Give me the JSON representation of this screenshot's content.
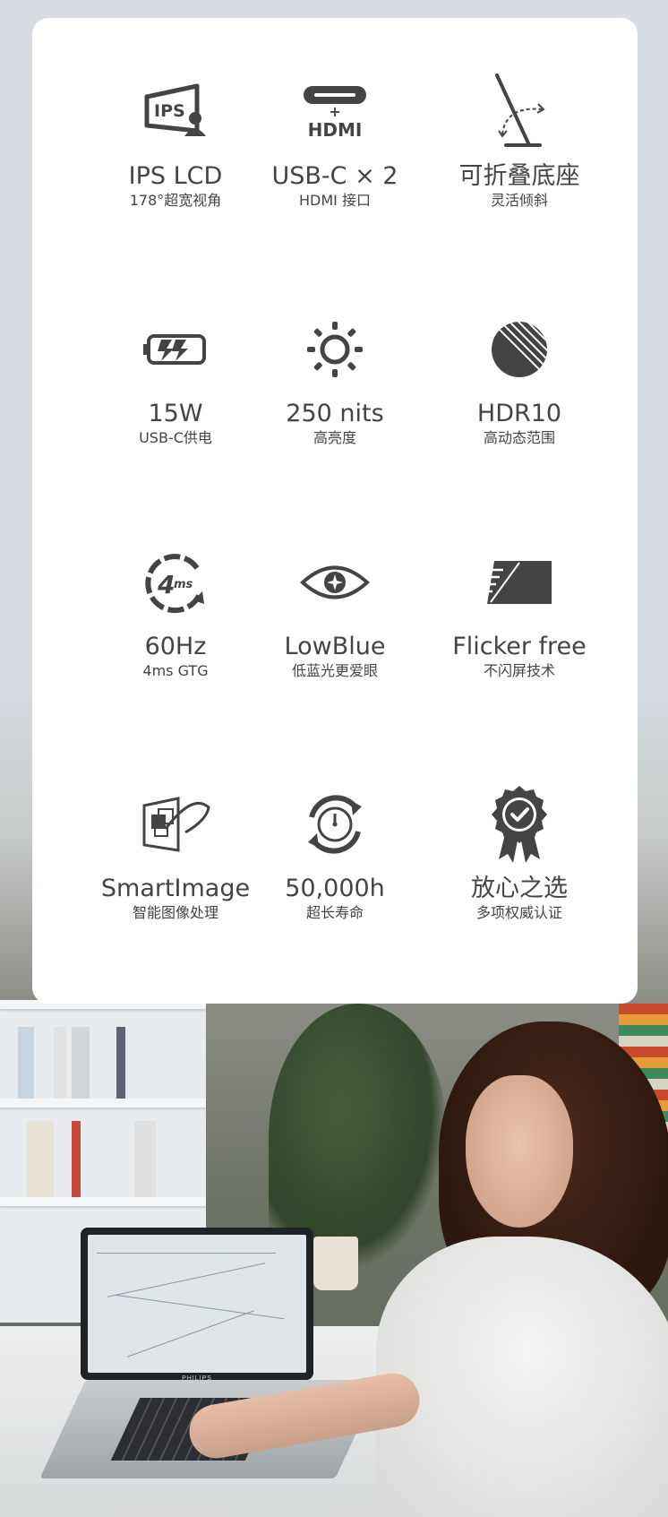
{
  "features": [
    {
      "icon": "ips-panel-icon",
      "title": "IPS LCD",
      "subtitle": "178°超宽视角",
      "badge": "IPS"
    },
    {
      "icon": "usb-c-hdmi-icon",
      "title": "USB-C × 2",
      "subtitle": "HDMI 接口",
      "badge": "HDMI"
    },
    {
      "icon": "foldable-stand-icon",
      "title": "可折叠底座",
      "subtitle": "灵活倾斜"
    },
    {
      "icon": "battery-charging-icon",
      "title": "15W",
      "subtitle": "USB-C供电"
    },
    {
      "icon": "sun-brightness-icon",
      "title": "250 nits",
      "subtitle": "高亮度"
    },
    {
      "icon": "hdr-sphere-icon",
      "title": "HDR10",
      "subtitle": "高动态范围"
    },
    {
      "icon": "response-time-icon",
      "title": "60Hz",
      "subtitle": "4ms GTG",
      "badge": "4ms"
    },
    {
      "icon": "eye-icon",
      "title": "LowBlue",
      "subtitle": "低蓝光更爱眼"
    },
    {
      "icon": "flicker-free-screen-icon",
      "title": "Flicker free",
      "subtitle": "不闪屏技术"
    },
    {
      "icon": "smartimage-icon",
      "title": "SmartImage",
      "subtitle": "智能图像处理"
    },
    {
      "icon": "lifespan-clock-icon",
      "title": "50,000h",
      "subtitle": "超长寿命"
    },
    {
      "icon": "certified-badge-icon",
      "title": "放心之选",
      "subtitle": "多项权威认证"
    }
  ],
  "monitor_brand": "PHILIPS",
  "colors": {
    "card": "#ffffff",
    "icon": "#444444",
    "text": "#444444"
  }
}
